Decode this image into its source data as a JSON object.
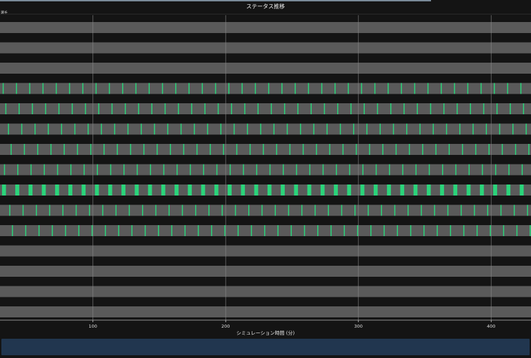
{
  "chart_data": {
    "type": "timeline",
    "title": "ステータス推移",
    "legend_label": "選手",
    "xlabel": "シミュレーション時間 (分)",
    "xlim": [
      30,
      430
    ],
    "xticks": [
      100,
      200,
      300,
      400
    ],
    "grid": true,
    "colors": {
      "background": "#141414",
      "band": "#5a5a5a",
      "grid": "#8a8a8a",
      "active": "#2bd47a"
    },
    "rows": [
      {
        "active": false,
        "period": 0,
        "phase": 0,
        "width": 0
      },
      {
        "active": false,
        "period": 0,
        "phase": 0,
        "width": 0
      },
      {
        "active": false,
        "period": 0,
        "phase": 0,
        "width": 0
      },
      {
        "active": true,
        "period": 10,
        "phase": 2,
        "width": 0.6
      },
      {
        "active": true,
        "period": 10,
        "phase": 4,
        "width": 0.6
      },
      {
        "active": true,
        "period": 10,
        "phase": 6,
        "width": 0.6
      },
      {
        "active": true,
        "period": 10,
        "phase": 8,
        "width": 0.6
      },
      {
        "active": true,
        "period": 10,
        "phase": 3,
        "width": 0.6
      },
      {
        "active": true,
        "period": 10,
        "phase": 1.5,
        "width": 2.5
      },
      {
        "active": true,
        "period": 10,
        "phase": 7,
        "width": 0.6
      },
      {
        "active": true,
        "period": 10,
        "phase": 9,
        "width": 0.6
      },
      {
        "active": false,
        "period": 0,
        "phase": 0,
        "width": 0
      },
      {
        "active": false,
        "period": 0,
        "phase": 0,
        "width": 0
      },
      {
        "active": false,
        "period": 0,
        "phase": 0,
        "width": 0
      },
      {
        "active": false,
        "period": 0,
        "phase": 0,
        "width": 0
      }
    ]
  },
  "scrollbar": {
    "label": "horizontal-scroll"
  }
}
